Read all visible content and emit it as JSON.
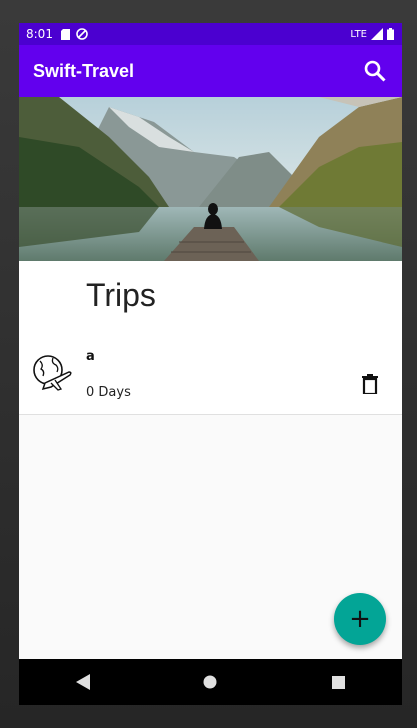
{
  "status_bar": {
    "time": "8:01",
    "network": "LTE",
    "icons": [
      "sd-card-icon",
      "do-not-disturb-icon",
      "signal-icon",
      "battery-icon"
    ]
  },
  "app_bar": {
    "title": "Swift-Travel",
    "action_icon": "search-icon",
    "background": "#6200ee"
  },
  "hero": {
    "image": "mountain-lake-landscape"
  },
  "section": {
    "title": "Trips"
  },
  "trips": [
    {
      "name": "a",
      "duration": "0 Days",
      "icon": "globe-plane-icon",
      "action_icon": "delete-icon"
    }
  ],
  "fab": {
    "icon": "add-icon",
    "label": "+",
    "color": "#03a596"
  },
  "nav_bar": {
    "buttons": [
      "back-icon",
      "home-icon",
      "recents-icon"
    ]
  }
}
